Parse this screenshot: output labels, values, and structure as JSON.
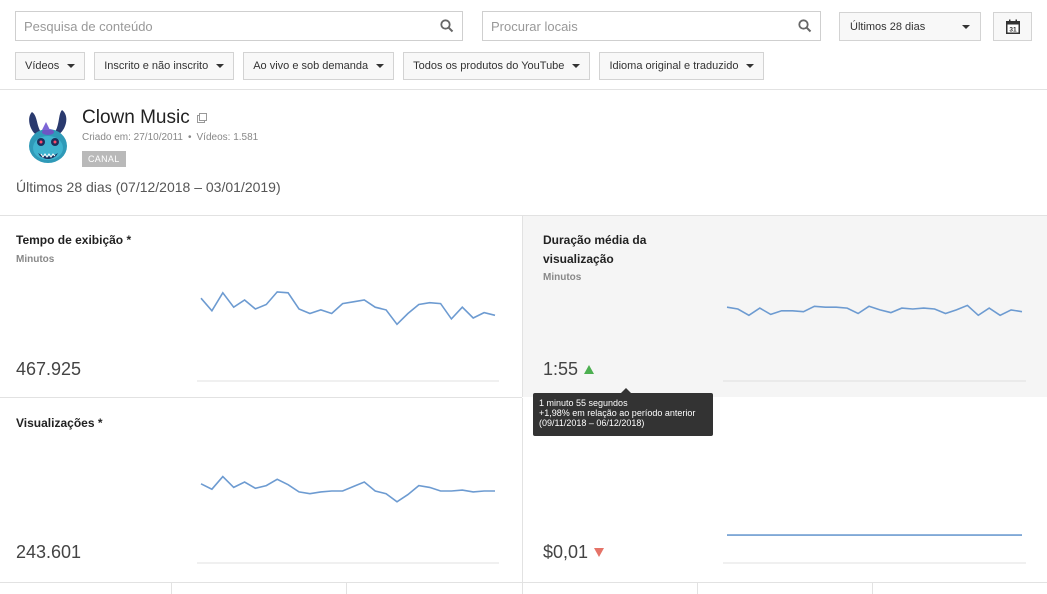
{
  "search": {
    "content_placeholder": "Pesquisa de conteúdo",
    "locations_placeholder": "Procurar locais"
  },
  "period_select": {
    "value": "Últimos 28 dias"
  },
  "calendar_button": {
    "day": "31"
  },
  "filters": [
    {
      "label": "Vídeos"
    },
    {
      "label": "Inscrito e não inscrito"
    },
    {
      "label": "Ao vivo e sob demanda"
    },
    {
      "label": "Todos os produtos do YouTube"
    },
    {
      "label": "Idioma original e traduzido"
    }
  ],
  "channel": {
    "name": "Clown Music",
    "created": "Criado em: 27/10/2011",
    "videos": "Vídeos: 1.581",
    "badge": "CANAL"
  },
  "period_label": "Últimos 28 dias (07/12/2018 – 03/01/2019)",
  "metrics": [
    {
      "title": "Tempo de exibição *",
      "subtitle": "Minutos",
      "value": "467.925",
      "trend": "none",
      "sparkline": [
        62,
        48,
        68,
        52,
        60,
        50,
        55,
        69,
        68,
        50,
        45,
        49,
        45,
        56,
        58,
        60,
        52,
        49,
        33,
        45,
        55,
        57,
        56,
        39,
        52,
        40,
        46,
        43
      ]
    },
    {
      "title": "Duração média da visualização",
      "subtitle": "Minutos",
      "value": "1:55",
      "trend": "up",
      "sparkline": [
        52,
        50,
        43,
        51,
        44,
        48,
        48,
        47,
        53,
        52,
        52,
        51,
        45,
        53,
        49,
        46,
        51,
        50,
        51,
        50,
        45,
        49,
        54,
        43,
        51,
        43,
        49,
        47
      ]
    },
    {
      "title": "Visualizações *",
      "subtitle": "",
      "value": "243.601",
      "trend": "none",
      "sparkline": [
        58,
        52,
        66,
        54,
        60,
        53,
        56,
        63,
        57,
        49,
        47,
        49,
        50,
        50,
        55,
        60,
        50,
        47,
        38,
        46,
        56,
        54,
        50,
        50,
        51,
        49,
        50,
        50
      ]
    },
    {
      "title": "",
      "subtitle": "",
      "value": "$0,01",
      "trend": "down",
      "sparkline": [
        1,
        1,
        1,
        1,
        1,
        1,
        1,
        1,
        1,
        1,
        1,
        1,
        1,
        1,
        1,
        1,
        1,
        1,
        1,
        1,
        1,
        1,
        1,
        1,
        1,
        1,
        1,
        1
      ]
    }
  ],
  "tooltip": {
    "line1": "1 minuto 55 segundos",
    "line2": "+1,98% em relação ao período anterior",
    "line3": "(09/11/2018 – 06/12/2018)"
  },
  "colors": {
    "sparkline": "#6d9bd1",
    "trend_up": "#4caf50",
    "trend_down": "#e57368",
    "highlight_panel": "#f5f5f5"
  }
}
